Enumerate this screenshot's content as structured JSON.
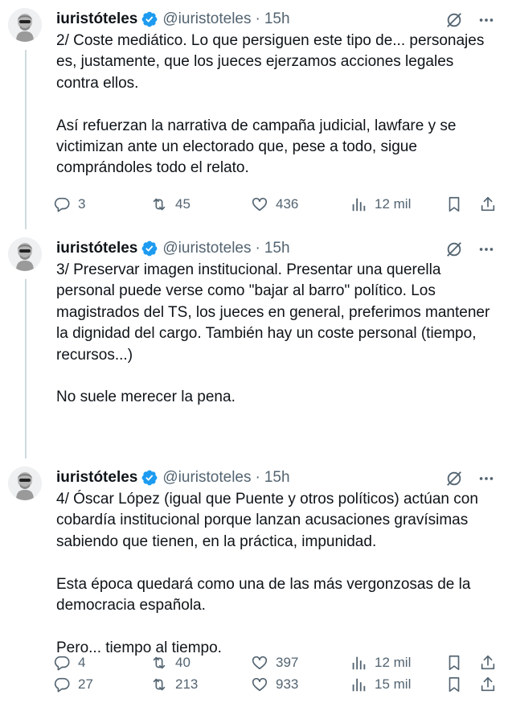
{
  "tweets": [
    {
      "name": "iuristóteles",
      "handle": "@iuristoteles",
      "separator": "·",
      "time": "15h",
      "paragraphs": [
        "2/ Coste mediático. Lo que persiguen este tipo de... personajes es, justamente, que los jueces ejerzamos acciones legales contra ellos.",
        "Así refuerzan la narrativa de campaña judicial, lawfare y se victimizan ante un electorado que, pese a todo, sigue comprándoles todo el relato."
      ],
      "replies": "3",
      "retweets": "45",
      "likes": "436",
      "views": "12 mil"
    },
    {
      "name": "iuristóteles",
      "handle": "@iuristoteles",
      "separator": "·",
      "time": "15h",
      "paragraphs": [
        "3/ Preservar imagen institucional. Presentar una querella personal puede verse como \"bajar al barro\" político. Los magistrados del TS, los jueces en general, preferimos mantener la dignidad del cargo. También hay un coste personal (tiempo, recursos...)",
        "No suele merecer la pena."
      ],
      "replies": "4",
      "retweets": "40",
      "likes": "397",
      "views": "12 mil"
    },
    {
      "name": "iuristóteles",
      "handle": "@iuristoteles",
      "separator": "·",
      "time": "15h",
      "paragraphs": [
        "4/ Óscar López (igual que Puente y otros políticos) actúan con cobardía institucional porque lanzan acusaciones gravísimas sabiendo que tienen, en la práctica, impunidad.",
        "Esta época quedará como una de las más vergonzosas de la democracia española.",
        "Pero... tiempo al tiempo."
      ],
      "replies": "27",
      "retweets": "213",
      "likes": "933",
      "views": "15 mil"
    }
  ],
  "icons": {
    "verified": "verified-badge-icon",
    "grok": "grok-icon",
    "more": "more-icon",
    "reply": "reply-icon",
    "retweet": "retweet-icon",
    "like": "heart-icon",
    "views": "views-icon",
    "bookmark": "bookmark-icon",
    "share": "share-icon"
  },
  "colors": {
    "text": "#0f1419",
    "secondary": "#536471",
    "verified": "#1d9bf0",
    "thread_line": "#cfd9de"
  }
}
